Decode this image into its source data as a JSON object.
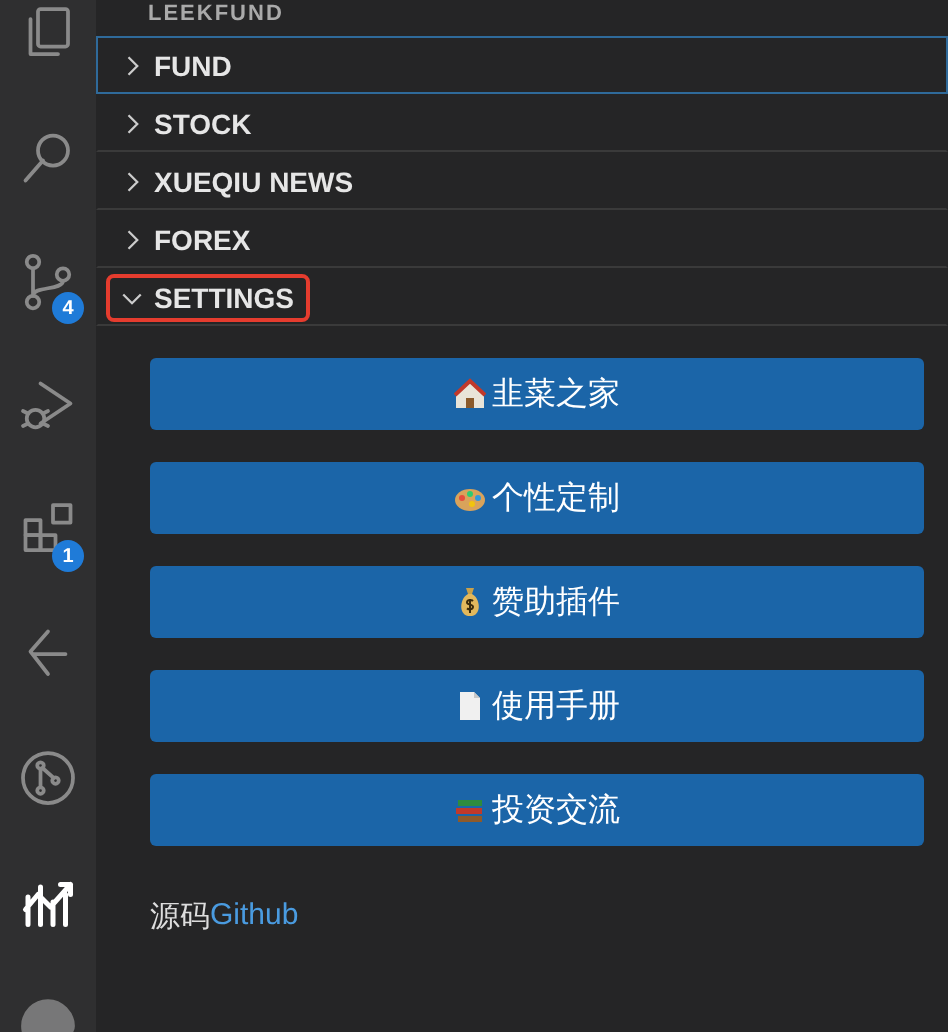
{
  "activity_bar": {
    "items": [
      {
        "selected": false
      },
      {
        "selected": false
      },
      {
        "badge": "4",
        "selected": false
      },
      {
        "selected": false
      },
      {
        "badge": "1",
        "selected": false
      },
      {
        "selected": false
      },
      {
        "selected": false
      },
      {
        "selected": true
      },
      {
        "selected": false
      }
    ]
  },
  "sidebar": {
    "title": "LEEKFUND",
    "sections": [
      {
        "label": "FUND",
        "expanded": false,
        "focused": true,
        "highlighted": false
      },
      {
        "label": "STOCK",
        "expanded": false,
        "focused": false,
        "highlighted": false
      },
      {
        "label": "XUEQIU NEWS",
        "expanded": false,
        "focused": false,
        "highlighted": false
      },
      {
        "label": "FOREX",
        "expanded": false,
        "focused": false,
        "highlighted": false
      },
      {
        "label": "SETTINGS",
        "expanded": true,
        "focused": false,
        "highlighted": true
      }
    ],
    "buttons": [
      "韭菜之家",
      "个性定制",
      "赞助插件",
      "使用手册",
      "投资交流"
    ],
    "source": {
      "label": "源码",
      "link": "Github"
    }
  }
}
